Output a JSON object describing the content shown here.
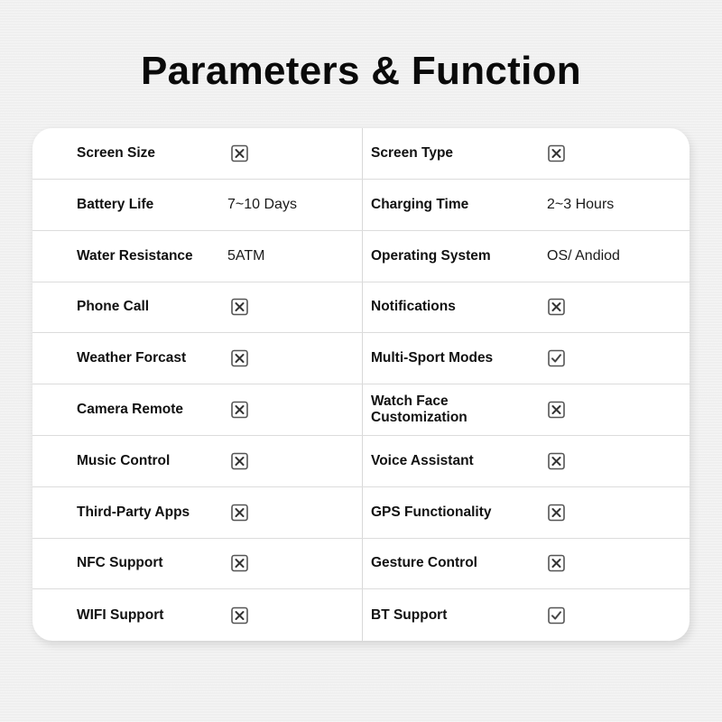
{
  "title": "Parameters & Function",
  "rows": [
    {
      "left": {
        "label": "Screen Size",
        "type": "icon",
        "icon": "x-box-icon",
        "value": ""
      },
      "right": {
        "label": "Screen Type",
        "type": "icon",
        "icon": "x-box-icon",
        "value": ""
      }
    },
    {
      "left": {
        "label": "Battery Life",
        "type": "text",
        "value": "7~10 Days"
      },
      "right": {
        "label": "Charging Time",
        "type": "text",
        "value": "2~3 Hours"
      }
    },
    {
      "left": {
        "label": "Water Resistance",
        "type": "text",
        "value": "5ATM"
      },
      "right": {
        "label": "Operating System",
        "type": "text",
        "value": "OS/ Andiod"
      }
    },
    {
      "left": {
        "label": "Phone Call",
        "type": "icon",
        "icon": "x-box-icon",
        "value": ""
      },
      "right": {
        "label": "Notifications",
        "type": "icon",
        "icon": "x-box-icon",
        "value": ""
      }
    },
    {
      "left": {
        "label": "Weather Forcast",
        "type": "icon",
        "icon": "x-box-icon",
        "value": ""
      },
      "right": {
        "label": "Multi-Sport Modes",
        "type": "icon",
        "icon": "check-box-icon",
        "value": ""
      }
    },
    {
      "left": {
        "label": "Camera Remote",
        "type": "icon",
        "icon": "x-box-icon",
        "value": ""
      },
      "right": {
        "label": "Watch Face Customization",
        "type": "icon",
        "icon": "x-box-icon",
        "value": ""
      }
    },
    {
      "left": {
        "label": "Music Control",
        "type": "icon",
        "icon": "x-box-icon",
        "value": ""
      },
      "right": {
        "label": "Voice Assistant",
        "type": "icon",
        "icon": "x-box-icon",
        "value": ""
      }
    },
    {
      "left": {
        "label": "Third-Party Apps",
        "type": "icon",
        "icon": "x-box-icon",
        "value": ""
      },
      "right": {
        "label": "GPS Functionality",
        "type": "icon",
        "icon": "x-box-icon",
        "value": ""
      }
    },
    {
      "left": {
        "label": "NFC Support",
        "type": "icon",
        "icon": "x-box-icon",
        "value": ""
      },
      "right": {
        "label": "Gesture Control",
        "type": "icon",
        "icon": "x-box-icon",
        "value": ""
      }
    },
    {
      "left": {
        "label": "WIFI Support",
        "type": "icon",
        "icon": "x-box-icon",
        "value": ""
      },
      "right": {
        "label": "BT Support",
        "type": "icon",
        "icon": "check-box-icon",
        "value": ""
      }
    }
  ],
  "colors": {
    "icon_stroke": "#555555",
    "text": "#111111",
    "card": "#ffffff",
    "background": "#efefef"
  }
}
